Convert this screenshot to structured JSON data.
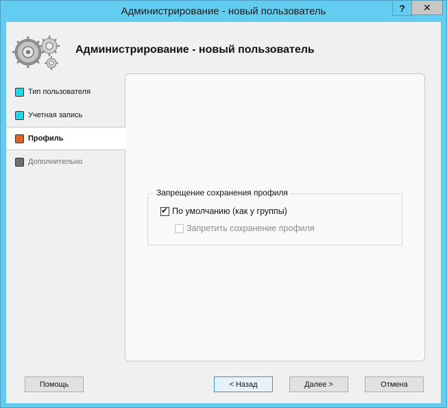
{
  "window": {
    "title": "Администрирование - новый пользователь",
    "help_label": "?",
    "close_label": "✕"
  },
  "header": {
    "title": "Администрирование - новый пользователь"
  },
  "sidebar": {
    "items": [
      {
        "label": "Тип пользователя",
        "state": "done",
        "color": "#18d9e6"
      },
      {
        "label": "Учетная запись",
        "state": "done",
        "color": "#18d9e6"
      },
      {
        "label": "Профиль",
        "state": "active",
        "color": "#e8621a"
      },
      {
        "label": "Дополнительно",
        "state": "disabled",
        "color": "#6e6e6e"
      }
    ]
  },
  "profile": {
    "group_title": "Запрещение сохранения профиля",
    "default_option": {
      "label": "По умолчанию (как у группы)",
      "checked": true
    },
    "deny_option": {
      "label": "Запретить сохранение профиля",
      "checked": false,
      "enabled": false
    }
  },
  "buttons": {
    "help": "Помощь",
    "back": "< Назад",
    "next": "Далее >",
    "cancel": "Отмена"
  }
}
